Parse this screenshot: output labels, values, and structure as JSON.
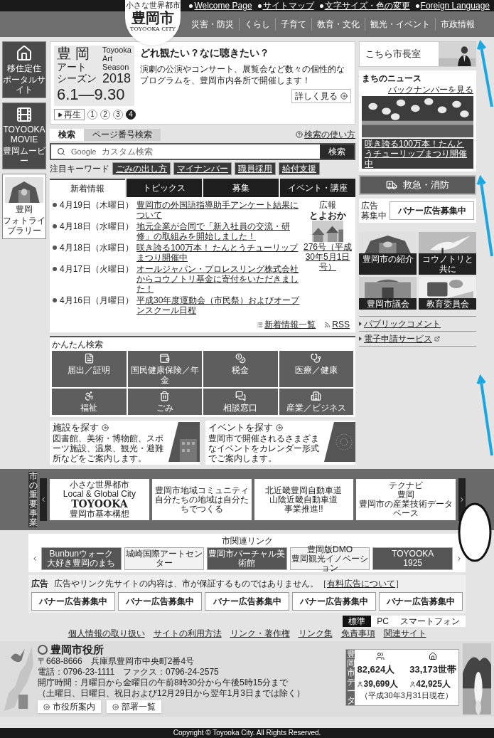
{
  "top_links": [
    "Welcome Page",
    "サイトマップ",
    "文字サイズ・色の変更",
    "Foreign Language"
  ],
  "logo": {
    "tagline": "小さな世界都市",
    "name": "豊岡市",
    "romaji": "TOYOOKA CITY"
  },
  "nav": [
    "災害・防災",
    "くらし",
    "子育て",
    "教育・文化",
    "観光・イベント",
    "市政情報"
  ],
  "sidebar": [
    {
      "kind": "house",
      "lines": [
        "移住定住",
        "ポータルサイト"
      ]
    },
    {
      "kind": "film",
      "lines": [
        "TOYOOKA MOVIE",
        "豊岡ムービー"
      ]
    },
    {
      "lines": [
        "豊岡",
        "フォトライブラリー"
      ]
    }
  ],
  "hero": {
    "title_lines": [
      "豊 岡",
      "アート",
      "シーズン"
    ],
    "en_lines": [
      "Toyooka",
      "Art",
      "Season"
    ],
    "year": "2018",
    "dates": "6.1―9.30",
    "headline": "どれ観たい？なに聴きたい？",
    "body": "演劇の公演やコンサート、展覧会など数々の個性的なプログラムを、豊岡市内各所で開催します！",
    "more": "詳しく見る",
    "play": "再生",
    "pages": [
      {
        "label": "1",
        "selected": false
      },
      {
        "label": "2",
        "selected": false
      },
      {
        "label": "3",
        "selected": false
      },
      {
        "label": "4",
        "selected": true
      }
    ]
  },
  "search": {
    "tabs": [
      {
        "label": "検索",
        "selected": true
      },
      {
        "label": "ページ番号検索",
        "selected": false
      }
    ],
    "help": "検索の使い方",
    "brand": "Google",
    "placeholder": "カスタム検索",
    "button": "検索",
    "keywords_label": "注目キーワード",
    "keywords": [
      "ごみの出し方",
      "マイナンバー",
      "職員採用",
      "給付支援"
    ]
  },
  "news": {
    "tabs": [
      {
        "label": "新着情報",
        "selected": true
      },
      {
        "label": "トピックス",
        "selected": false
      },
      {
        "label": "募集",
        "selected": false
      },
      {
        "label": "イベント・講座",
        "selected": false
      }
    ],
    "items": [
      {
        "date": "4月19日（木曜日）",
        "title": "豊岡市の外国語指導助手アンケート結果について"
      },
      {
        "date": "4月18日（水曜日）",
        "title": "地元企業が合同で「新入社員の交流・研修」の取組みを開始しました！"
      },
      {
        "date": "4月18日（水曜日）",
        "title": "咲き誇る100万本！ たんとうチューリップまつり開催中"
      },
      {
        "date": "4月17日（火曜日）",
        "title": "オールジャパン・プロレスリング株式会社からコウノトリ基金に寄付をいただきました！"
      },
      {
        "date": "4月16日（月曜日）",
        "title": "平成30年度運動会（市民祭）およびオープンスクール日程"
      }
    ],
    "koho": {
      "label": "広報",
      "name": "とよおか",
      "issue": "276号（平成30年5月1日号）"
    },
    "footer_links": [
      "新着情報一覧",
      "RSS"
    ]
  },
  "quick_search": {
    "title": "かんたん検索",
    "items": [
      {
        "kind": "form",
        "label": "届出／証明"
      },
      {
        "kind": "insurance",
        "label": "国民健康保険／年金"
      },
      {
        "kind": "tax",
        "label": "税金"
      },
      {
        "kind": "medical",
        "label": "医療／健康"
      },
      {
        "kind": "welfare",
        "label": "福祉"
      },
      {
        "kind": "garbage",
        "label": "ごみ"
      },
      {
        "kind": "consult",
        "label": "相談窓口"
      },
      {
        "kind": "business",
        "label": "産業／ビジネス"
      }
    ]
  },
  "finders": [
    {
      "kind": "building",
      "title": "施設を探す",
      "body": "図書館、美術・博物館、スポーツ施設、温泉、観光・避難所などをご案内します。"
    },
    {
      "kind": "calendar",
      "title": "イベントを探す",
      "body": "豊岡市で開催されるさまざまなイベントをカレンダー形式でご案内します。"
    }
  ],
  "right": {
    "mayor": "こちら市長室",
    "news_title": "まちのニュース",
    "back_numbers": "バックナンバーを見る",
    "news_caption": "咲き誇る100万本！たんとうチューリップまつり開催中",
    "emergency": "救急・消防",
    "ad_label": "広告",
    "ad_sub": "募集中",
    "ad_banner": "バナー広告募集中",
    "tiles": [
      "豊岡市の紹介",
      "コウノトリと共に",
      "豊岡市議会",
      "教育委員会"
    ],
    "links": [
      {
        "label": "パブリックコメント",
        "external": false
      },
      {
        "label": "電子申請サービス",
        "external": true
      }
    ]
  },
  "projects": {
    "title": "市の重要事業",
    "banners": [
      {
        "lines": [
          "小さな世界都市",
          "Local & Global City",
          "TOYOOKA",
          "豊岡市基本構想"
        ]
      },
      {
        "lines": [
          "豊岡市地域コミュニティ",
          "自分たちの地域は自分たちでつくる"
        ]
      },
      {
        "lines": [
          "北近畿豊岡自動車道",
          "山陰近畿自動車道",
          "事業推進!!"
        ]
      },
      {
        "lines": [
          "テクナビ",
          "豊岡",
          "豊岡市の産業技術データベース"
        ]
      }
    ]
  },
  "related": {
    "title": "市関連リンク",
    "banners": [
      {
        "lines": [
          "Bunbunウォーク",
          "大好き豊岡のまち"
        ]
      },
      {
        "lines": [
          "城崎国際アートセンター"
        ]
      },
      {
        "lines": [
          "豊岡市バーチャル美術館"
        ]
      },
      {
        "lines": [
          "豊岡版DMO",
          "豊岡観光イノベーション"
        ]
      },
      {
        "lines": [
          "TOYOOKA",
          "1925"
        ]
      }
    ]
  },
  "ads": {
    "label": "広告",
    "notice": "広告やリンク先サイトの内容は、市が保証するものではありません。［",
    "notice_link": "有料広告について",
    "notice_close": "］",
    "banners": [
      "バナー広告募集中",
      "バナー広告募集中",
      "バナー広告募集中",
      "バナー広告募集中",
      "バナー広告募集中"
    ]
  },
  "display": [
    {
      "label": "標準",
      "selected": true
    },
    {
      "label": "PC",
      "selected": false
    },
    {
      "label": "スマートフォン",
      "selected": false
    }
  ],
  "footer_links": [
    "個人情報の取り扱い",
    "サイトの利用方法",
    "リンク・著作権",
    "リンク集",
    "免責事項",
    "関連サイト"
  ],
  "office": {
    "name": "豊岡市役所",
    "lines": [
      "〒668-8666　兵庫県豊岡市中央町2番4号",
      "電話：0796-23-1111　ファクス：0796-24-2575",
      "開庁時間：月曜日から金曜日の午前8時30分から午後5時15分まで",
      "（土曜日、日曜日、祝日および12月29日から翌年1月3日までは除く）"
    ],
    "buttons": [
      "市役所案内",
      "部署一覧"
    ]
  },
  "city_data": {
    "title": "豊岡市データ",
    "population": "82,624",
    "population_unit": "人",
    "households": "33,173",
    "households_unit": "世帯",
    "male": "39,699",
    "female": "42,925",
    "male_unit": "人",
    "female_unit": "人",
    "as_of": "（平成30年3月31日現在）"
  },
  "copyright": "Copyright © Toyooka City. All Rights Reserved."
}
